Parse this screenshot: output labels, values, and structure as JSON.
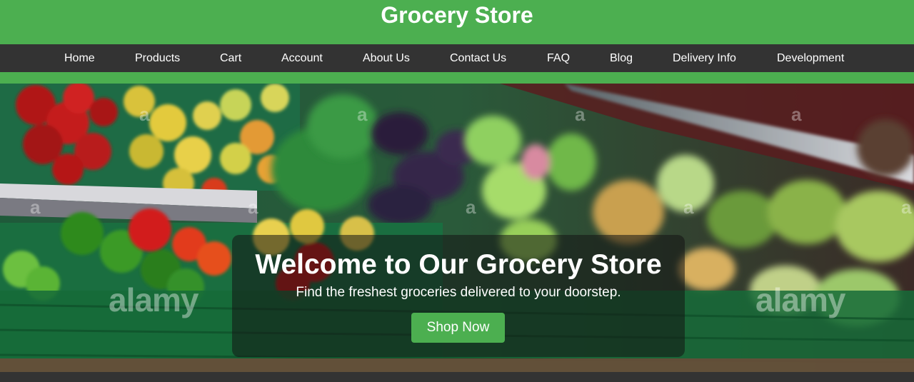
{
  "header": {
    "title": "Grocery Store",
    "brand_color": "#4caf50"
  },
  "nav": {
    "items": [
      {
        "label": "Home"
      },
      {
        "label": "Products"
      },
      {
        "label": "Cart"
      },
      {
        "label": "Account"
      },
      {
        "label": "About Us"
      },
      {
        "label": "Contact Us"
      },
      {
        "label": "FAQ"
      },
      {
        "label": "Blog"
      },
      {
        "label": "Delivery Info"
      },
      {
        "label": "Development"
      }
    ],
    "background_color": "#333333"
  },
  "hero": {
    "image": "produce-aisle-photo",
    "watermark_text": "alamy",
    "title": "Welcome to Our Grocery Store",
    "subtitle": "Find the freshest groceries delivered to your doorstep.",
    "button_label": "Shop Now",
    "button_color": "#4caf50"
  }
}
